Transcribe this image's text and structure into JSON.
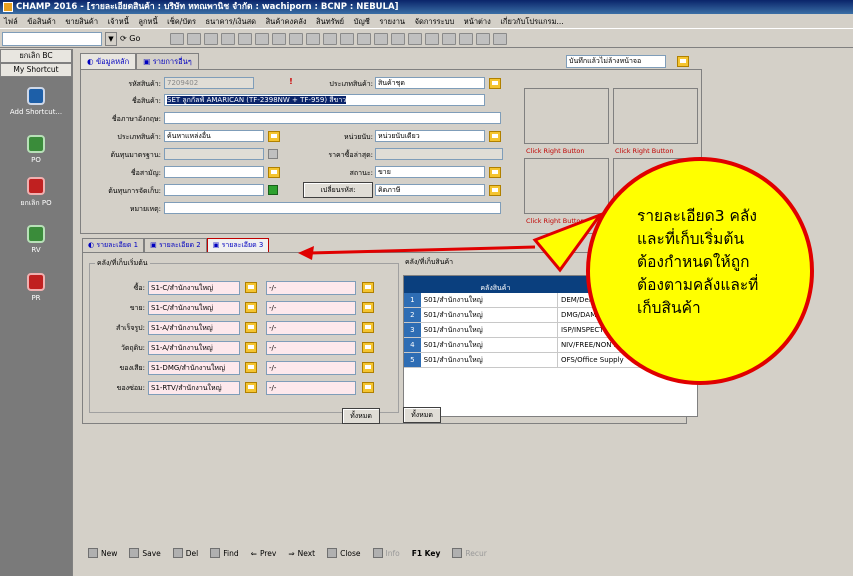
{
  "window": {
    "title": "CHAMP 2016 - [รายละเอียดสินค้า : บริษัท หทณพานิช จำกัด : wachiporn : BCNP : NEBULA]"
  },
  "menu": [
    "ไฟล์",
    "ข้อสินค้า",
    "ขายสินค้า",
    "เจ้าหนี้",
    "ลูกหนี้",
    "เช็ค/บัตร",
    "ธนาคาร/เงินสด",
    "สินค้าคงคลัง",
    "สินทรัพย์",
    "บัญชี",
    "รายงาน",
    "จัดการระบบ",
    "หน้าต่าง",
    "เกี่ยวกับโปรแกรม..."
  ],
  "toolbar": {
    "go_label": "Go"
  },
  "sidebar": {
    "tab_cancel_bc": "ยกเลิก BC",
    "tab_shortcut": "My Shortcut",
    "items": [
      {
        "label": "Add Shortcut..."
      },
      {
        "label": "PO"
      },
      {
        "label": "ยกเลิก PO"
      },
      {
        "label": "RV"
      },
      {
        "label": "PR"
      }
    ]
  },
  "main_tabs": [
    "ข้อมูลหลัก",
    "รายการอื่นๆ"
  ],
  "save_mode": "บันทึกแล้วไม่ล้างหน้าจอ",
  "form": {
    "product_code_label": "รหัสสินค้า:",
    "product_code": "7209402",
    "product_type_label": "ประเภทสินค้า:",
    "product_type": "สินค้าชุด",
    "product_name_label": "ชื่อสินค้า:",
    "product_name": "SET ลูกกัลฟ์ AMARICAN (TF-2398NW + TF-959) สีขาว",
    "english_name_label": "ชื่อภาษาอังกฤษ:",
    "category_label": "ประเภทสินค้า:",
    "category": "ค้นหาแหล่งอื่น",
    "unit_label": "หน่วยนับ:",
    "unit": "หน่วยนับเดียว",
    "standard_cost_label": "ต้นทุนมาตรฐาน:",
    "last_price_label": "ราคาซื้อล่าสุด:",
    "brand_label": "ชื่อสามัญ:",
    "status_label": "สถานะ:",
    "status": "ขาย",
    "cost_method_label": "ต้นทุนการจัดเก็บ:",
    "change_code_label": "เปลี่ยนรหัส:",
    "change_code": "คิดภาษี",
    "note_label": "หมายเหตุ:",
    "click_right_button": "Click Right Button"
  },
  "detail_tabs": [
    "รายละเอียด 1",
    "รายละเอียด 2",
    "รายละเอียด 3"
  ],
  "start_warehouse": {
    "title": "คลัง/ที่เก็บเริ่มต้น",
    "rows": [
      {
        "label": "ซื้อ:",
        "wh": "S1-C/สำนักงานใหญ่",
        "loc": "-/-"
      },
      {
        "label": "ขาย:",
        "wh": "S1-C/สำนักงานใหญ่",
        "loc": "-/-"
      },
      {
        "label": "สำเร็จรูป:",
        "wh": "S1-A/สำนักงานใหญ่",
        "loc": "-/-"
      },
      {
        "label": "วัตถุดิบ:",
        "wh": "S1-A/สำนักงานใหญ่",
        "loc": "-/-"
      },
      {
        "label": "ของเสีย:",
        "wh": "S1-DMG/สำนักงานใหญ่",
        "loc": "-/-"
      },
      {
        "label": "ของซ่อม:",
        "wh": "S1-RTV/สำนักงานใหญ่",
        "loc": "-/-"
      }
    ],
    "all_button": "ทั้งหมด"
  },
  "product_warehouse": {
    "title": "คลัง/ที่เก็บสินค้า",
    "col1": "คลังสินค้า",
    "rows": [
      {
        "n": "1",
        "wh": "S01/สำนักงานใหญ่",
        "loc": "DEM/Dem"
      },
      {
        "n": "2",
        "wh": "S01/สำนักงานใหญ่",
        "loc": "DMG/DAMA"
      },
      {
        "n": "3",
        "wh": "S01/สำนักงานใหญ่",
        "loc": "ISP/INSPECTIO"
      },
      {
        "n": "4",
        "wh": "S01/สำนักงานใหญ่",
        "loc": "NIV/FREE/NON INV"
      },
      {
        "n": "5",
        "wh": "S01/สำนักงานใหญ่",
        "loc": "OFS/Office Supply"
      }
    ],
    "all_button": "ทั้งหมด"
  },
  "bottom_bar": {
    "new": "New",
    "save": "Save",
    "del": "Del",
    "find": "Find",
    "prev": "Prev",
    "next": "Next",
    "close": "Close",
    "info": "Info",
    "f1": "F1 Key",
    "recur": "Recur"
  },
  "callout": {
    "lines": [
      "รายละเอียด3 คลัง",
      "และที่เก็บเริ่มต้น",
      "ต้องกำหนดให้ถูก",
      "ต้องตามคลังและที่",
      "เก็บสินค้า"
    ],
    "fill_color": "#ffff00",
    "border_color": "#e00000"
  }
}
